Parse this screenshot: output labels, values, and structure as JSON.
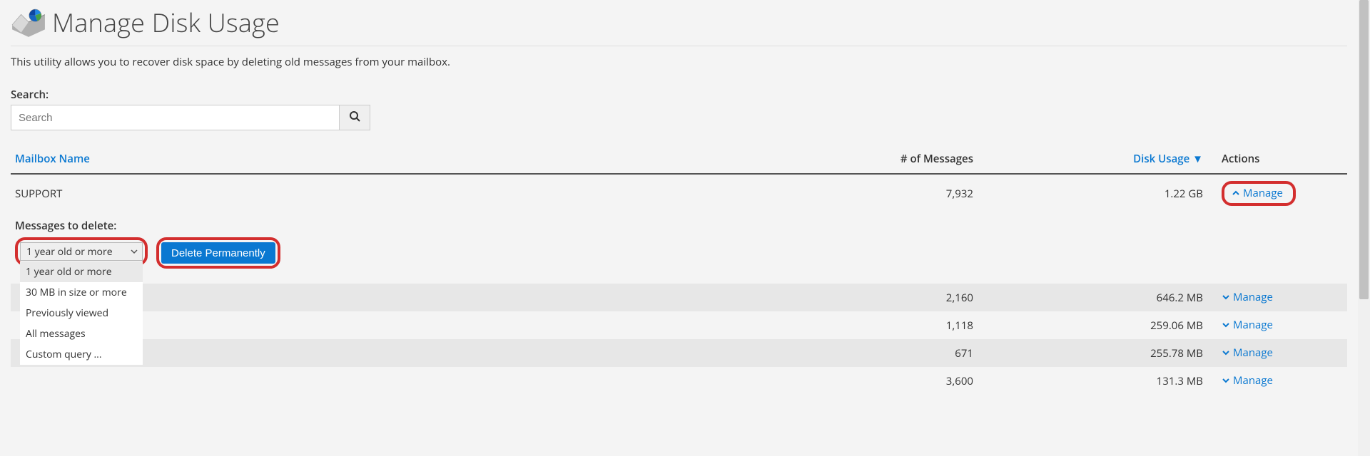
{
  "page": {
    "title": "Manage Disk Usage",
    "description": "This utility allows you to recover disk space by deleting old messages from your mailbox."
  },
  "search": {
    "label": "Search:",
    "placeholder": "Search"
  },
  "table": {
    "headers": {
      "mailbox": "Mailbox Name",
      "messages": "# of Messages",
      "disk": "Disk Usage",
      "sort_indicator": "▼",
      "actions": "Actions"
    },
    "rows": [
      {
        "name": "SUPPORT",
        "messages": "7,932",
        "disk": "1.22 GB",
        "expanded": true
      },
      {
        "name": "",
        "messages": "2,160",
        "disk": "646.2 MB",
        "expanded": false
      },
      {
        "name": "",
        "messages": "1,118",
        "disk": "259.06 MB",
        "expanded": false
      },
      {
        "name": "",
        "messages": "671",
        "disk": "255.78 MB",
        "expanded": false
      },
      {
        "name": "",
        "messages": "3,600",
        "disk": "131.3 MB",
        "expanded": false
      }
    ],
    "manage_label": "Manage"
  },
  "expanded_panel": {
    "label": "Messages to delete:",
    "selected": "1 year old or more",
    "options": [
      "1 year old or more",
      "30 MB in size or more",
      "Previously viewed",
      "All messages",
      "Custom query ..."
    ],
    "delete_btn": "Delete Permanently"
  }
}
